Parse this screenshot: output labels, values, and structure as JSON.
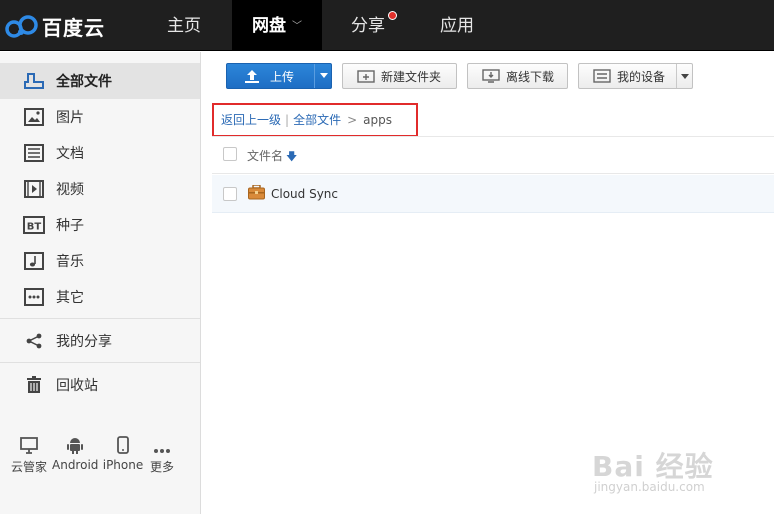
{
  "brand": {
    "name": "百度云"
  },
  "nav": {
    "items": [
      {
        "label": "主页"
      },
      {
        "label": "网盘"
      },
      {
        "label": "分享"
      },
      {
        "label": "应用"
      }
    ]
  },
  "sidebar": {
    "items": [
      {
        "label": "全部文件"
      },
      {
        "label": "图片"
      },
      {
        "label": "文档"
      },
      {
        "label": "视频"
      },
      {
        "label": "种子"
      },
      {
        "label": "音乐"
      },
      {
        "label": "其它"
      },
      {
        "label": "我的分享"
      },
      {
        "label": "回收站"
      }
    ],
    "devices": [
      {
        "label": "云管家"
      },
      {
        "label": "Android"
      },
      {
        "label": "iPhone"
      },
      {
        "label": "更多"
      }
    ]
  },
  "toolbar": {
    "upload": "上传",
    "new_folder": "新建文件夹",
    "offline_download": "离线下载",
    "my_devices": "我的设备"
  },
  "breadcrumb": {
    "back": "返回上一级",
    "root": "全部文件",
    "current": "apps"
  },
  "file_list": {
    "column_name": "文件名",
    "rows": [
      {
        "name": "Cloud Sync"
      }
    ]
  },
  "watermark": {
    "text": "Bai 经验",
    "sub": "jingyan.baidu.com"
  },
  "colors": {
    "accent": "#2b6ab5",
    "upload_button": "#1e6ec4",
    "highlight_box": "#e12b2b",
    "topbar": "#1f1f1f"
  }
}
